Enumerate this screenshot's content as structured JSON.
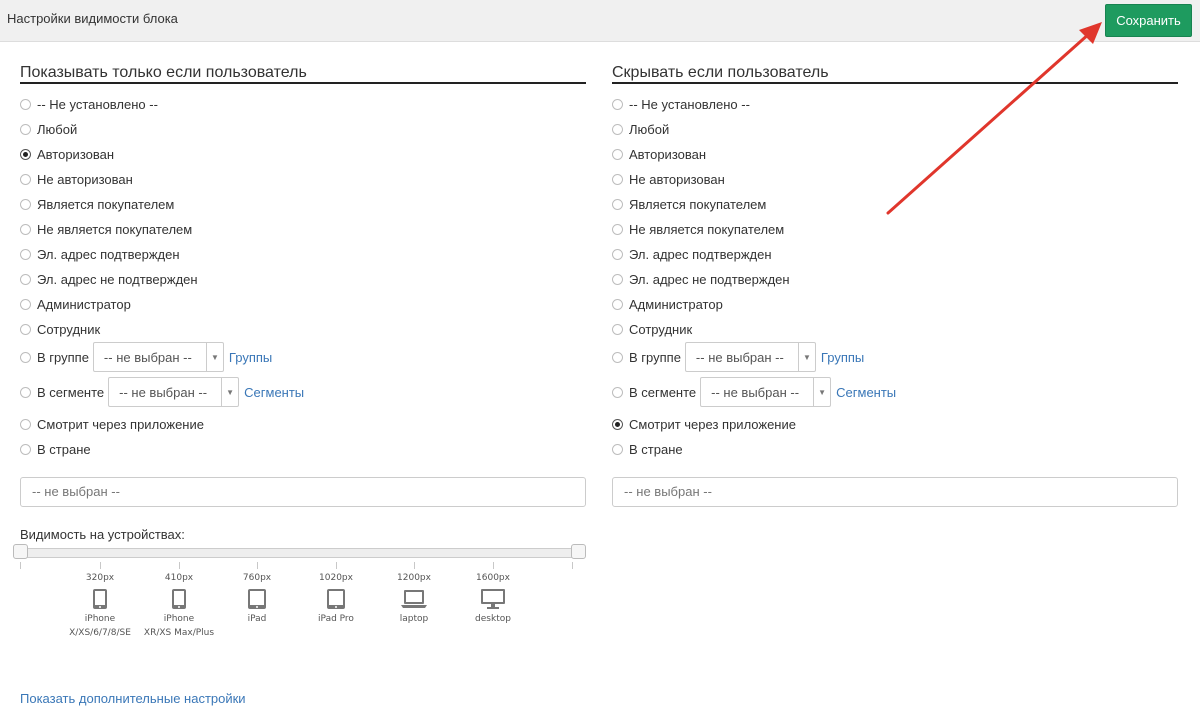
{
  "header": {
    "title": "Настройки видимости блока",
    "save_label": "Сохранить"
  },
  "show_column": {
    "title": "Показывать только если пользователь",
    "options": [
      "-- Не установлено --",
      "Любой",
      "Авторизован",
      "Не авторизован",
      "Является покупателем",
      "Не является покупателем",
      "Эл. адрес подтвержден",
      "Эл. адрес не подтвержден",
      "Администратор",
      "Сотрудник",
      "В группе",
      "В сегменте",
      "Смотрит через приложение",
      "В стране"
    ],
    "selected": "Авторизован",
    "group_select": "-- не выбран --",
    "group_link": "Группы",
    "segment_select": "-- не выбран --",
    "segment_link": "Сегменты",
    "country_select": "-- не выбран --"
  },
  "hide_column": {
    "title": "Скрывать если пользователь",
    "options": [
      "-- Не установлено --",
      "Любой",
      "Авторизован",
      "Не авторизован",
      "Является покупателем",
      "Не является покупателем",
      "Эл. адрес подтвержден",
      "Эл. адрес не подтвержден",
      "Администратор",
      "Сотрудник",
      "В группе",
      "В сегменте",
      "Смотрит через приложение",
      "В стране"
    ],
    "selected": "Смотрит через приложение",
    "group_select": "-- не выбран --",
    "group_link": "Группы",
    "segment_select": "-- не выбран --",
    "segment_link": "Сегменты",
    "country_select": "-- не выбран --"
  },
  "devices": {
    "label": "Видимость на устройствах:",
    "range_start": 0,
    "range_end": 1,
    "items": [
      {
        "px": "320px",
        "name": "iPhone",
        "sub": "X/XS/6/7/8/SE",
        "icon": "phone-icon"
      },
      {
        "px": "410px",
        "name": "iPhone",
        "sub": "XR/XS Max/Plus",
        "icon": "phone-icon"
      },
      {
        "px": "760px",
        "name": "iPad",
        "sub": "",
        "icon": "tablet-icon"
      },
      {
        "px": "1020px",
        "name": "iPad Pro",
        "sub": "",
        "icon": "tablet-icon"
      },
      {
        "px": "1200px",
        "name": "laptop",
        "sub": "",
        "icon": "laptop-icon"
      },
      {
        "px": "1600px",
        "name": "desktop",
        "sub": "",
        "icon": "desktop-icon"
      }
    ]
  },
  "more_settings_link": "Показать дополнительные настройки",
  "colors": {
    "save_button": "#1e9b5f",
    "link": "#3a77b7",
    "annotation_arrow": "#e0362c"
  }
}
